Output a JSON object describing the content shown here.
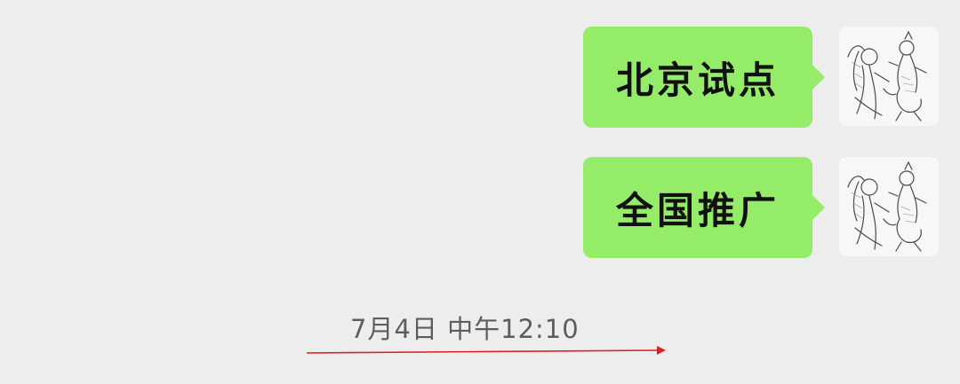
{
  "messages": [
    {
      "text": "北京试点",
      "sender": "self"
    },
    {
      "text": "全国推广",
      "sender": "self"
    }
  ],
  "timestamp": "7月4日  中午12:10",
  "colors": {
    "background": "#ededed",
    "bubble": "#95ec69",
    "bubble_text": "#111111",
    "timestamp_text": "#5d5d5d",
    "annotation_arrow": "#e02020"
  },
  "icons": {
    "avatar": "sketch-portrait-avatar",
    "annotation": "red-arrow-icon"
  }
}
